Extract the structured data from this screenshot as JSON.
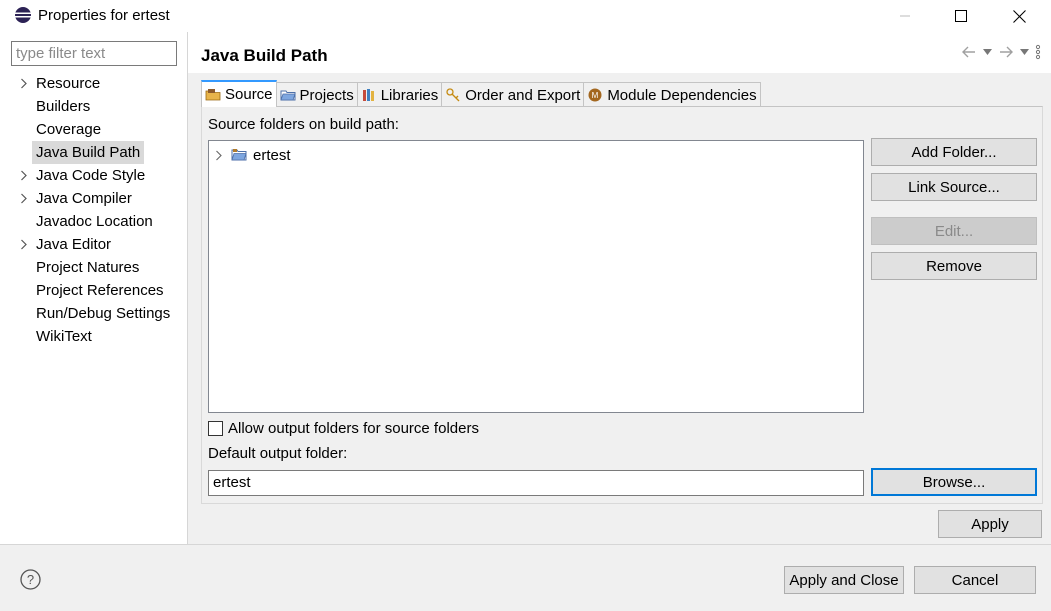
{
  "window": {
    "title": "Properties for ertest"
  },
  "filter": {
    "placeholder": "type filter text"
  },
  "tree": [
    {
      "label": "Resource",
      "expandable": true,
      "selected": false
    },
    {
      "label": "Builders",
      "expandable": false,
      "selected": false
    },
    {
      "label": "Coverage",
      "expandable": false,
      "selected": false
    },
    {
      "label": "Java Build Path",
      "expandable": false,
      "selected": true
    },
    {
      "label": "Java Code Style",
      "expandable": true,
      "selected": false
    },
    {
      "label": "Java Compiler",
      "expandable": true,
      "selected": false
    },
    {
      "label": "Javadoc Location",
      "expandable": false,
      "selected": false
    },
    {
      "label": "Java Editor",
      "expandable": true,
      "selected": false
    },
    {
      "label": "Project Natures",
      "expandable": false,
      "selected": false
    },
    {
      "label": "Project References",
      "expandable": false,
      "selected": false
    },
    {
      "label": "Run/Debug Settings",
      "expandable": false,
      "selected": false
    },
    {
      "label": "WikiText",
      "expandable": false,
      "selected": false
    }
  ],
  "page": {
    "title": "Java Build Path"
  },
  "tabs": [
    {
      "label": "Source",
      "icon": "source-tab-icon",
      "active": true
    },
    {
      "label": "Projects",
      "icon": "projects-tab-icon",
      "active": false
    },
    {
      "label": "Libraries",
      "icon": "libraries-tab-icon",
      "active": false
    },
    {
      "label": "Order and Export",
      "icon": "order-export-tab-icon",
      "active": false
    },
    {
      "label": "Module Dependencies",
      "icon": "module-dependencies-tab-icon",
      "active": false
    }
  ],
  "source": {
    "label": "Source folders on build path:",
    "folders": [
      "ertest"
    ],
    "buttons": {
      "add_folder": "Add Folder...",
      "link_source": "Link Source...",
      "edit": "Edit...",
      "remove": "Remove"
    },
    "allow_output_label": "Allow output folders for source folders",
    "allow_output_checked": false,
    "default_output_label": "Default output folder:",
    "default_output_value": "ertest",
    "browse": "Browse..."
  },
  "footer": {
    "apply": "Apply",
    "apply_and_close": "Apply and Close",
    "cancel": "Cancel"
  },
  "colors": {
    "accent": "#0078d7",
    "tab_active_top": "#3399ff"
  }
}
